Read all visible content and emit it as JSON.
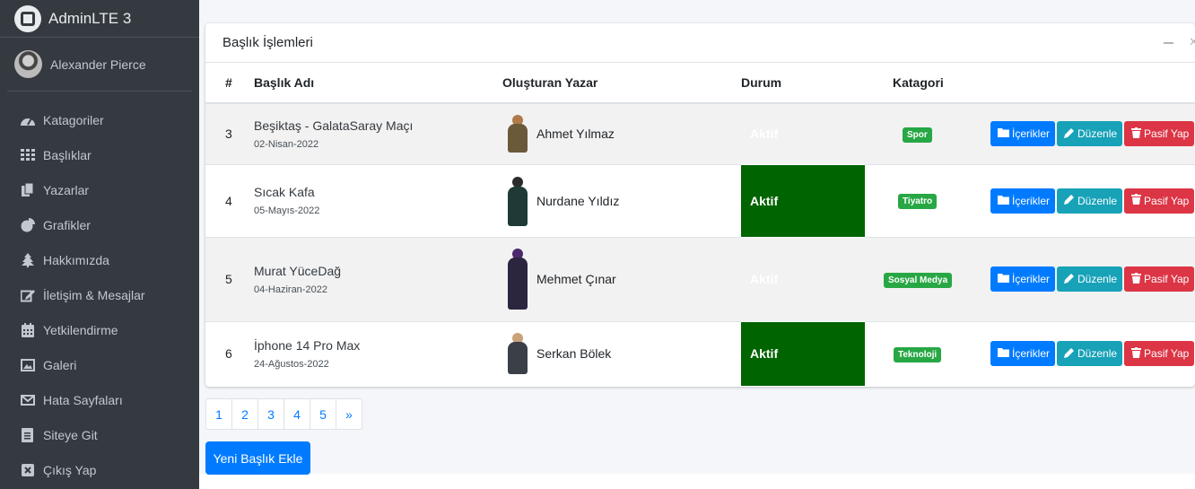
{
  "brand": {
    "name": "AdminLTE 3"
  },
  "user": {
    "name": "Alexander Pierce"
  },
  "sidebar": {
    "items": [
      {
        "label": "Katagoriler",
        "icon": "tachometer-icon"
      },
      {
        "label": "Başlıklar",
        "icon": "grid-icon"
      },
      {
        "label": "Yazarlar",
        "icon": "copy-icon"
      },
      {
        "label": "Grafikler",
        "icon": "pie-chart-icon"
      },
      {
        "label": "Hakkımızda",
        "icon": "tree-icon"
      },
      {
        "label": "İletişim & Mesajlar",
        "icon": "edit-icon"
      },
      {
        "label": "Yetkilendirme",
        "icon": "calendar-icon"
      },
      {
        "label": "Galeri",
        "icon": "image-icon"
      },
      {
        "label": "Hata Sayfaları",
        "icon": "envelope-icon"
      },
      {
        "label": "Siteye Git",
        "icon": "document-icon"
      },
      {
        "label": "Çıkış Yap",
        "icon": "close-square-icon"
      }
    ]
  },
  "card": {
    "title": "Başlık İşlemleri"
  },
  "table": {
    "headers": {
      "num": "#",
      "title": "Başlık Adı",
      "author": "Oluşturan Yazar",
      "status": "Durum",
      "category": "Katagori"
    },
    "rows": [
      {
        "id": "3",
        "title": "Beşiktaş - GalataSaray Maçı",
        "date": "02-Nisan-2022",
        "author": "Ahmet Yılmaz",
        "status": "Aktif",
        "category": "Spor"
      },
      {
        "id": "4",
        "title": "Sıcak Kafa",
        "date": "05-Mayıs-2022",
        "author": "Nurdane Yıldız",
        "status": "Aktif",
        "category": "Tiyatro"
      },
      {
        "id": "5",
        "title": "Murat YüceDağ",
        "date": "04-Haziran-2022",
        "author": "Mehmet Çınar",
        "status": "Aktif",
        "category": "Sosyal Medya"
      },
      {
        "id": "6",
        "title": "İphone 14 Pro Max",
        "date": "24-Ağustos-2022",
        "author": "Serkan Bölek",
        "status": "Aktif",
        "category": "Teknoloji"
      }
    ]
  },
  "actions": {
    "contents": "İçerikler",
    "edit": "Düzenle",
    "deactivate": "Pasif Yap"
  },
  "pagination": {
    "pages": [
      "1",
      "2",
      "3",
      "4",
      "5"
    ],
    "next": "»"
  },
  "add_button": {
    "label": "Yeni Başlık Ekle"
  },
  "colors": {
    "sidebar": "#343a40",
    "primary": "#007bff",
    "info": "#17a2b8",
    "danger": "#dc3545",
    "status_active": "#006400",
    "badge": "#28a745"
  }
}
